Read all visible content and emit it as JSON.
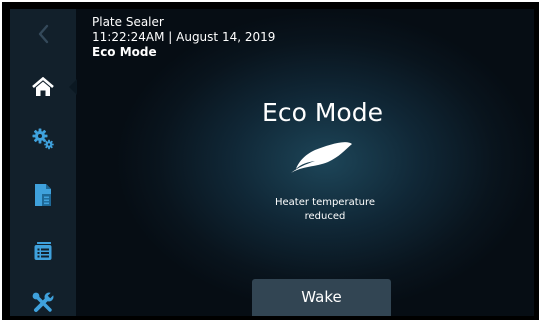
{
  "header": {
    "device_name": "Plate Sealer",
    "datetime": "11:22:24AM | August 14, 2019",
    "mode": "Eco Mode"
  },
  "sidebar": {
    "items": [
      {
        "icon": "back-chevron-icon",
        "active": false,
        "enabled": false
      },
      {
        "icon": "home-icon",
        "active": true
      },
      {
        "icon": "settings-gears-icon",
        "active": false
      },
      {
        "icon": "protocol-document-icon",
        "active": false
      },
      {
        "icon": "log-list-icon",
        "active": false
      },
      {
        "icon": "tools-icon",
        "active": false
      }
    ]
  },
  "main": {
    "title": "Eco Mode",
    "icon": "leaf-icon",
    "message_line1": "Heater temperature",
    "message_line2": "reduced",
    "wake_label": "Wake"
  },
  "colors": {
    "accent": "#3fa1dc",
    "background": "#0b1822",
    "sidebar": "#12202b",
    "button": "#324553",
    "text": "#ffffff"
  }
}
